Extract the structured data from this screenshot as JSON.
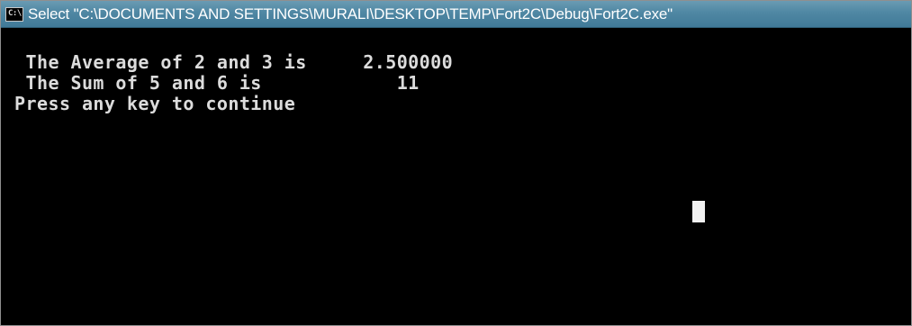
{
  "window": {
    "title": "Select \"C:\\DOCUMENTS AND SETTINGS\\MURALI\\DESKTOP\\TEMP\\Fort2C\\Debug\\Fort2C.exe\"",
    "icon": "console-icon",
    "icon_text": "C:\\"
  },
  "console": {
    "lines": [
      " The Average of 2 and 3 is     2.500000",
      " The Sum of 5 and 6 is            11",
      "Press any key to continue"
    ]
  },
  "colors": {
    "background": "#000000",
    "text": "#dcdcdc",
    "titlebar": "#4f87a3"
  }
}
